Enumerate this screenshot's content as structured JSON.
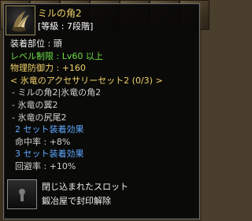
{
  "item": {
    "name": "ミルの角2",
    "grade": "[等級 : 7段階]",
    "icon": "horn-item-icon"
  },
  "stats": {
    "slot": "装着部位 : 頭",
    "level_req": "レベル制限 : Lv60 以上",
    "phys_def": "物理防御力 : +160",
    "set_name": "< 氷竜のアクセサリーセット2 (0/3) >",
    "set_items": [
      "- ミルの角2|氷竜の角2",
      "- 氷竜の翼2",
      "- 氷竜の尻尾2"
    ],
    "set_bonus_2_title": "2 セット装着効果",
    "set_bonus_2_value": "命中率 : +8%",
    "set_bonus_3_title": "3 セット装着効果",
    "set_bonus_3_value": "回避率 : +10%"
  },
  "sealed_slot": {
    "title": "閉じ込まれたスロット",
    "desc": "鍛冶屋で封印解除",
    "icon": "keyhole-icon"
  },
  "colors": {
    "name": "#f2d36a",
    "level": "#6ee04a",
    "set_header": "#f2d36a",
    "set_bonus": "#5fa8ff"
  }
}
